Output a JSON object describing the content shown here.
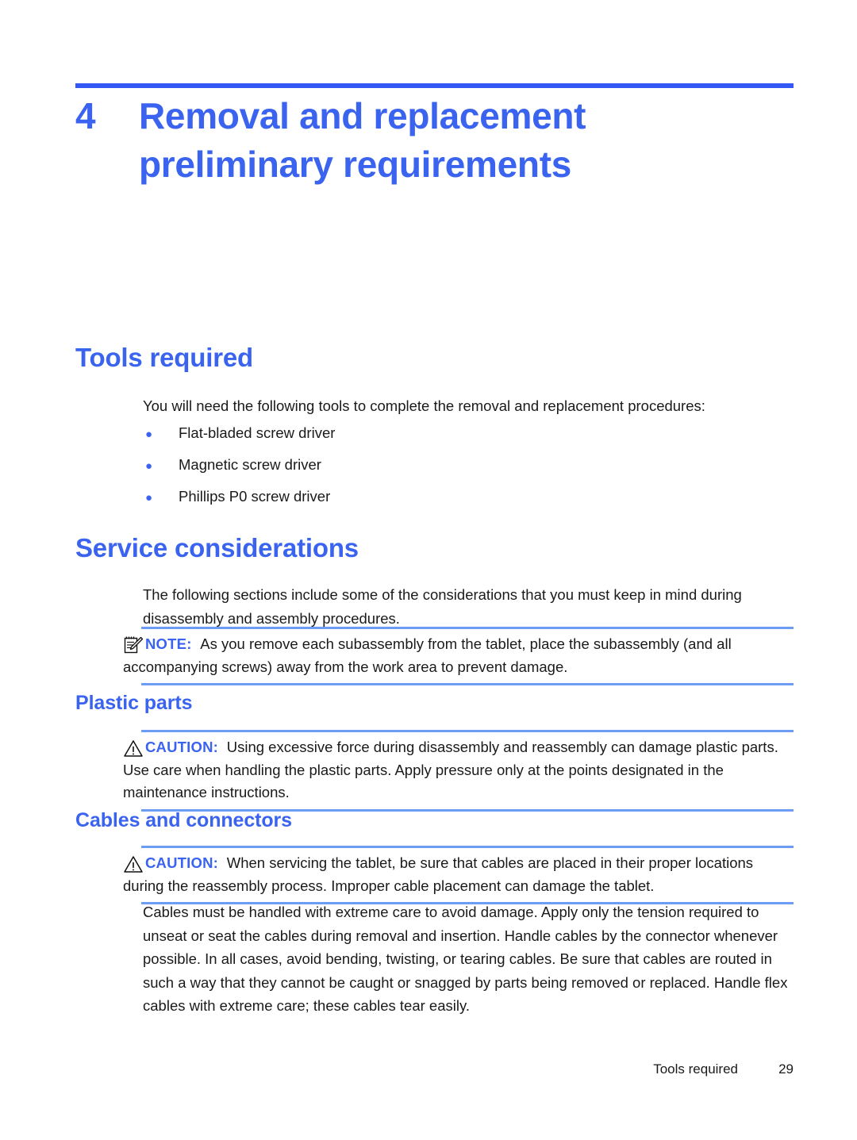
{
  "theme": {
    "accent_blue": "#3a63ef",
    "rule_blue": "#3358f4",
    "admonition_rule_blue": "#6d9cf5",
    "body_text": "#1a1a1a",
    "page_background": "#ffffff"
  },
  "chapter": {
    "number": "4",
    "title": "Removal and replacement preliminary requirements"
  },
  "sections": {
    "tools_required": {
      "heading": "Tools required",
      "intro": "You will need the following tools to complete the removal and replacement procedures:",
      "bullets": [
        {
          "bullet_icon": "bullet-dot-icon",
          "label": "Flat-bladed screw driver"
        },
        {
          "bullet_icon": "bullet-dot-icon",
          "label": "Magnetic screw driver"
        },
        {
          "bullet_icon": "bullet-dot-icon",
          "label": "Phillips P0 screw driver"
        }
      ]
    },
    "service_considerations": {
      "heading": "Service considerations",
      "intro": "The following sections include some of the considerations that you must keep in mind during disassembly and assembly procedures.",
      "note": {
        "icon": "note-pad-pencil-icon",
        "keyword": "NOTE:",
        "text": "As you remove each subassembly from the tablet, place the subassembly (and all accompanying screws) away from the work area to prevent damage."
      }
    },
    "plastic_parts": {
      "heading": "Plastic parts",
      "caution": {
        "icon": "warning-triangle-icon",
        "keyword": "CAUTION:",
        "text": "Using excessive force during disassembly and reassembly can damage plastic parts. Use care when handling the plastic parts. Apply pressure only at the points designated in the maintenance instructions."
      }
    },
    "cables_and_connectors": {
      "heading": "Cables and connectors",
      "caution": {
        "icon": "warning-triangle-icon",
        "keyword": "CAUTION:",
        "text": "When servicing the tablet, be sure that cables are placed in their proper locations during the reassembly process. Improper cable placement can damage the tablet."
      },
      "body": "Cables must be handled with extreme care to avoid damage. Apply only the tension required to unseat or seat the cables during removal and insertion. Handle cables by the connector whenever possible. In all cases, avoid bending, twisting, or tearing cables. Be sure that cables are routed in such a way that they cannot be caught or snagged by parts being removed or replaced. Handle flex cables with extreme care; these cables tear easily."
    }
  },
  "footer": {
    "section_title": "Tools required",
    "page_number": "29"
  }
}
